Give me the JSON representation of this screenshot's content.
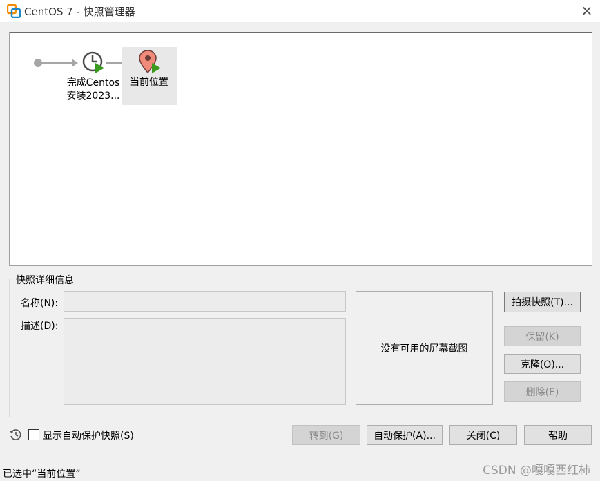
{
  "window": {
    "title": "CentOS 7  - 快照管理器"
  },
  "tree": {
    "nodes": [
      {
        "label_line1": "完成Centos",
        "label_line2": "安装2023..."
      },
      {
        "label": "当前位置"
      }
    ]
  },
  "details": {
    "group_title": "快照详细信息",
    "name_label": "名称(N):",
    "name_value": "",
    "desc_label": "描述(D):",
    "desc_value": "",
    "screenshot_text": "没有可用的屏幕截图"
  },
  "side_buttons": {
    "take_snapshot": "拍摄快照(T)...",
    "keep": "保留(K)",
    "clone": "克隆(O)...",
    "delete": "删除(E)"
  },
  "bottom": {
    "autosave_checkbox_label": "显示自动保护快照(S)",
    "autosave_checked": false,
    "goto": "转到(G)",
    "autoprotect": "自动保护(A)...",
    "close": "关闭(C)",
    "help": "帮助"
  },
  "status": {
    "text": "已选中“当前位置”"
  },
  "watermark": "CSDN @嘎嘎西红柿",
  "colors": {
    "pin": "#f08a7a",
    "play": "#3a9a1e",
    "arrow": "#a6a6a6"
  },
  "icons": {
    "app": "vmware-icon",
    "snapshot": "clock-icon",
    "current": "location-pin-icon",
    "history": "history-icon"
  }
}
